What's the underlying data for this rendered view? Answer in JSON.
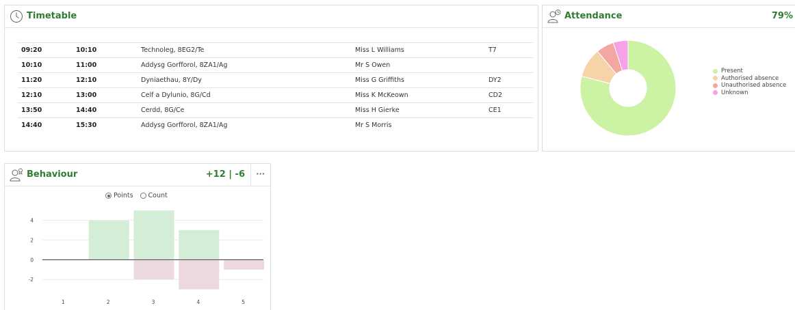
{
  "timetable": {
    "title": "Timetable",
    "rows": [
      {
        "start": "09:20",
        "end": "10:10",
        "lesson": "Technoleg, 8EG2/Te",
        "teacher": "Miss L Williams",
        "room": "T7"
      },
      {
        "start": "10:10",
        "end": "11:00",
        "lesson": "Addysg Gorfforol, 8ZA1/Ag",
        "teacher": "Mr S Owen",
        "room": ""
      },
      {
        "start": "11:20",
        "end": "12:10",
        "lesson": "Dyniaethau, 8Y/Dy",
        "teacher": "Miss G Griffiths",
        "room": "DY2"
      },
      {
        "start": "12:10",
        "end": "13:00",
        "lesson": "Celf a Dylunio, 8G/Cd",
        "teacher": "Miss K McKeown",
        "room": "CD2"
      },
      {
        "start": "13:50",
        "end": "14:40",
        "lesson": "Cerdd, 8G/Ce",
        "teacher": "Miss H Gierke",
        "room": "CE1"
      },
      {
        "start": "14:40",
        "end": "15:30",
        "lesson": "Addysg Gorfforol, 8ZA1/Ag",
        "teacher": "Mr S Morris",
        "room": ""
      }
    ]
  },
  "attendance": {
    "title": "Attendance",
    "percent": "79%",
    "legend": [
      {
        "label": "Present",
        "color": "#ccf2a4"
      },
      {
        "label": "Authorised absence",
        "color": "#f7d4a8"
      },
      {
        "label": "Unauthorised absence",
        "color": "#f4a6a0"
      },
      {
        "label": "Unknown",
        "color": "#f5a3e6"
      }
    ]
  },
  "behaviour": {
    "title": "Behaviour",
    "score": "+12 | -6",
    "more": "···",
    "options": {
      "points": "Points",
      "count": "Count"
    }
  },
  "chart_data": [
    {
      "type": "pie",
      "categories": [
        "Present",
        "Authorised absence",
        "Unauthorised absence",
        "Unknown"
      ],
      "values": [
        79,
        10,
        6,
        5
      ],
      "colors": [
        "#ccf2a4",
        "#f7d4a8",
        "#f4a6a0",
        "#f5a3e6"
      ],
      "title": "",
      "legend": "right"
    },
    {
      "type": "bar",
      "categories": [
        "1",
        "2",
        "3",
        "4",
        "5"
      ],
      "series": [
        {
          "values": [
            0,
            4,
            5,
            3,
            0
          ],
          "color": "#d4edd6"
        },
        {
          "values": [
            0,
            0,
            -2,
            -3,
            -1
          ],
          "color": "#ecd8df"
        }
      ],
      "yticks": [
        -2,
        0,
        2,
        4
      ],
      "ylim": [
        -3.3,
        5.5
      ],
      "grid": true
    }
  ]
}
